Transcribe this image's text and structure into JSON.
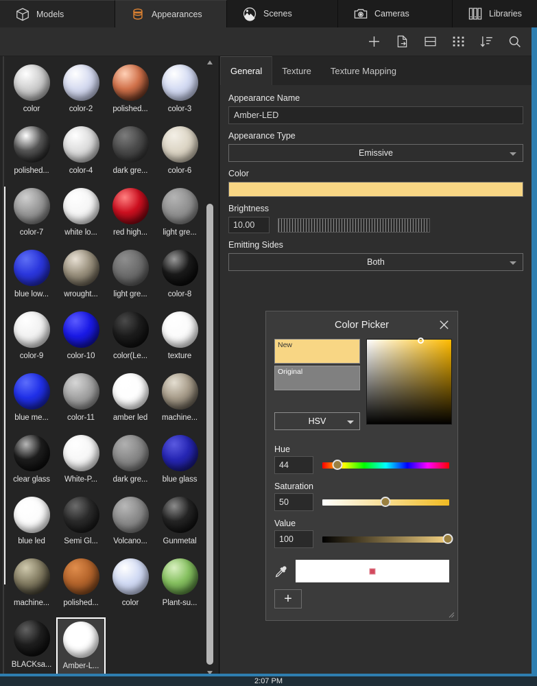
{
  "tabs": [
    {
      "label": "Models",
      "icon": "cube-icon",
      "active": false
    },
    {
      "label": "Appearances",
      "icon": "appearances-icon",
      "active": true
    },
    {
      "label": "Scenes",
      "icon": "scenes-icon",
      "active": false
    },
    {
      "label": "Cameras",
      "icon": "camera-icon",
      "active": false
    },
    {
      "label": "Libraries",
      "icon": "libraries-icon",
      "active": false
    }
  ],
  "toolbar": {
    "icons": [
      "plus-icon",
      "export-icon",
      "list-view-icon",
      "grid-view-icon",
      "sort-icon",
      "search-icon"
    ]
  },
  "library": {
    "items": [
      {
        "label": "color",
        "c1": "#ffffff",
        "c2": "#cfcfcf",
        "c3": "#9b9b9b"
      },
      {
        "label": "color-2",
        "c1": "#ffffff",
        "c2": "#d6dbf0",
        "c3": "#aab1cf"
      },
      {
        "label": "polished...",
        "c1": "#ffd0b6",
        "c2": "#d0714a",
        "c3": "#3a1a0e"
      },
      {
        "label": "color-3",
        "c1": "#ffffff",
        "c2": "#d5dcf3",
        "c3": "#b2bada"
      },
      {
        "label": "polished...",
        "c1": "#ffffff",
        "c2": "#555555",
        "c3": "#0a0a0a"
      },
      {
        "label": "color-4",
        "c1": "#ffffff",
        "c2": "#dedede",
        "c3": "#a8a8a8"
      },
      {
        "label": "dark gre...",
        "c1": "#7c7c7c",
        "c2": "#4b4b4b",
        "c3": "#262626"
      },
      {
        "label": "color-6",
        "c1": "#f3efe6",
        "c2": "#ddd6c6",
        "c3": "#b4ab99"
      },
      {
        "label": "color-7",
        "c1": "#cfcfcf",
        "c2": "#9a9a9a",
        "c3": "#6a6a6a"
      },
      {
        "label": "white lo...",
        "c1": "#ffffff",
        "c2": "#f6f6f6",
        "c3": "#dcdcdc"
      },
      {
        "label": "red high...",
        "c1": "#ff8080",
        "c2": "#cc1020",
        "c3": "#5a0008"
      },
      {
        "label": "light gre...",
        "c1": "#b4b4b4",
        "c2": "#939393",
        "c3": "#777777"
      },
      {
        "label": "blue low...",
        "c1": "#5d6ef5",
        "c2": "#2b37dd",
        "c3": "#1a1fa0"
      },
      {
        "label": "wrought...",
        "c1": "#e8e0d4",
        "c2": "#9b927f",
        "c3": "#4d4639"
      },
      {
        "label": "light gre...",
        "c1": "#8e8e8e",
        "c2": "#6e6e6e",
        "c3": "#4e4e4e"
      },
      {
        "label": "color-8",
        "c1": "#9a9a9a",
        "c2": "#1a1a1a",
        "c3": "#000000"
      },
      {
        "label": "color-9",
        "c1": "#ffffff",
        "c2": "#f2f2f2",
        "c3": "#c9c9c9"
      },
      {
        "label": "color-10",
        "c1": "#5b5bff",
        "c2": "#1a1ae6",
        "c3": "#0b0b8a"
      },
      {
        "label": "color(Le...",
        "c1": "#4a4a4a",
        "c2": "#1c1c1c",
        "c3": "#060606"
      },
      {
        "label": "texture",
        "c1": "#ffffff",
        "c2": "#fbfbfb",
        "c3": "#e6e6e6"
      },
      {
        "label": "blue me...",
        "c1": "#5c6dfb",
        "c2": "#2030e8",
        "c3": "#121a8e"
      },
      {
        "label": "color-11",
        "c1": "#d6d6d6",
        "c2": "#a4a4a4",
        "c3": "#7c7c7c"
      },
      {
        "label": "amber led",
        "c1": "#ffffff",
        "c2": "#fefefe",
        "c3": "#f0f0f0"
      },
      {
        "label": "machine...",
        "c1": "#e4ded1",
        "c2": "#a89d8b",
        "c3": "#4c463c"
      },
      {
        "label": "clear glass",
        "c1": "#b7b7b7",
        "c2": "#1d1d1d",
        "c3": "#030303"
      },
      {
        "label": "White-P...",
        "c1": "#ffffff",
        "c2": "#f7f7f7",
        "c3": "#dadada"
      },
      {
        "label": "dark gre...",
        "c1": "#b0b0b0",
        "c2": "#8a8a8a",
        "c3": "#6a6a6a"
      },
      {
        "label": "blue glass",
        "c1": "#5a5ae0",
        "c2": "#2626b4",
        "c3": "#121266"
      },
      {
        "label": "blue led",
        "c1": "#ffffff",
        "c2": "#fcfcfc",
        "c3": "#efefef"
      },
      {
        "label": "Semi Gl...",
        "c1": "#6c6c6c",
        "c2": "#2a2a2a",
        "c3": "#0c0c0c"
      },
      {
        "label": "Volcano...",
        "c1": "#b8b8b8",
        "c2": "#8d8d8d",
        "c3": "#6e6e6e"
      },
      {
        "label": "Gunmetal",
        "c1": "#8c8c8c",
        "c2": "#242424",
        "c3": "#050505"
      },
      {
        "label": "machine...",
        "c1": "#cfc9ad",
        "c2": "#847d63",
        "c3": "#211e16"
      },
      {
        "label": "polished...",
        "c1": "#e08d4c",
        "c2": "#b5652c",
        "c3": "#6b3a17"
      },
      {
        "label": "color",
        "c1": "#ffffff",
        "c2": "#d2dbf4",
        "c3": "#b4bddd"
      },
      {
        "label": "Plant-su...",
        "c1": "#d8f0c0",
        "c2": "#86c060",
        "c3": "#3e6a2c"
      },
      {
        "label": "BLACKsa...",
        "c1": "#626262",
        "c2": "#1e1e1e",
        "c3": "#020202"
      },
      {
        "label": "Amber-L...",
        "c1": "#ffffff",
        "c2": "#ffffff",
        "c3": "#f8f8f8",
        "selected": true
      }
    ]
  },
  "inspector": {
    "subtabs": [
      {
        "label": "General",
        "active": true
      },
      {
        "label": "Texture",
        "active": false
      },
      {
        "label": "Texture Mapping",
        "active": false
      }
    ],
    "appearance_name_label": "Appearance Name",
    "appearance_name_value": "Amber-LED",
    "appearance_type_label": "Appearance Type",
    "appearance_type_value": "Emissive",
    "color_label": "Color",
    "color_value": "#f8d684",
    "brightness_label": "Brightness",
    "brightness_value": "10.00",
    "emitting_sides_label": "Emitting Sides",
    "emitting_sides_value": "Both"
  },
  "color_picker": {
    "title": "Color Picker",
    "close_icon": "close-icon",
    "new_label": "New",
    "new_color": "#f8d684",
    "original_label": "Original",
    "original_color": "#808080",
    "mode_value": "HSV",
    "hue_label": "Hue",
    "hue_value": "44",
    "saturation_label": "Saturation",
    "saturation_value": "50",
    "value_label": "Value",
    "value_value": "100",
    "eyedropper_icon": "eyedropper-icon",
    "add_label": "+",
    "swatch_color": "#ffffff"
  },
  "taskbar": {
    "clock": "2:07 PM"
  },
  "accents": {
    "blue_edge": "#2e7eb0",
    "tab_orange": "#d98032"
  }
}
